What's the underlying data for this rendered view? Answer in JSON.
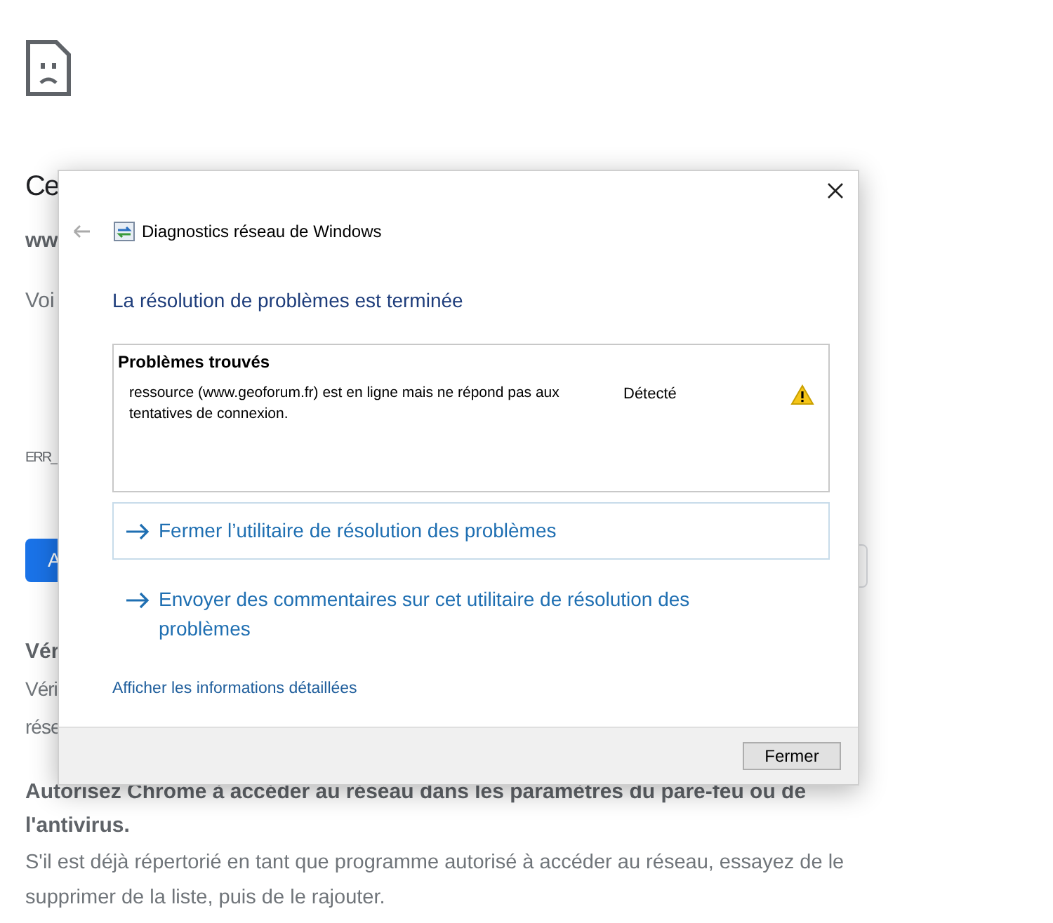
{
  "page": {
    "heading": "Ce",
    "subheading": "ww",
    "description": "Voi",
    "error_code": "ERR_",
    "primary_button": "A",
    "sections": [
      {
        "title": "Vér",
        "lines": [
          "Véri",
          "rése"
        ]
      },
      {
        "title": "Autorisez Chrome à accéder au réseau dans les paramètres du pare-feu ou de l'antivirus.",
        "lines": [
          "S'il est déjà répertorié en tant que programme autorisé à accéder au réseau, essayez de le supprimer de la liste, puis de le rajouter."
        ]
      }
    ]
  },
  "dialog": {
    "title": "Diagnostics réseau de Windows",
    "heading": "La résolution de problèmes est terminée",
    "problems": {
      "title": "Problèmes trouvés",
      "items": [
        {
          "description": "ressource (www.geoforum.fr) est en ligne mais ne répond pas aux tentatives de connexion.",
          "status": "Détecté",
          "kind": "warning"
        }
      ]
    },
    "actions": [
      {
        "label": "Fermer l’utilitaire de résolution des problèmes",
        "highlighted": true
      },
      {
        "label": "Envoyer des commentaires sur cet utilitaire de résolution des problèmes",
        "highlighted": false
      }
    ],
    "details_link": "Afficher les informations détaillées",
    "close_button": "Fermer"
  }
}
